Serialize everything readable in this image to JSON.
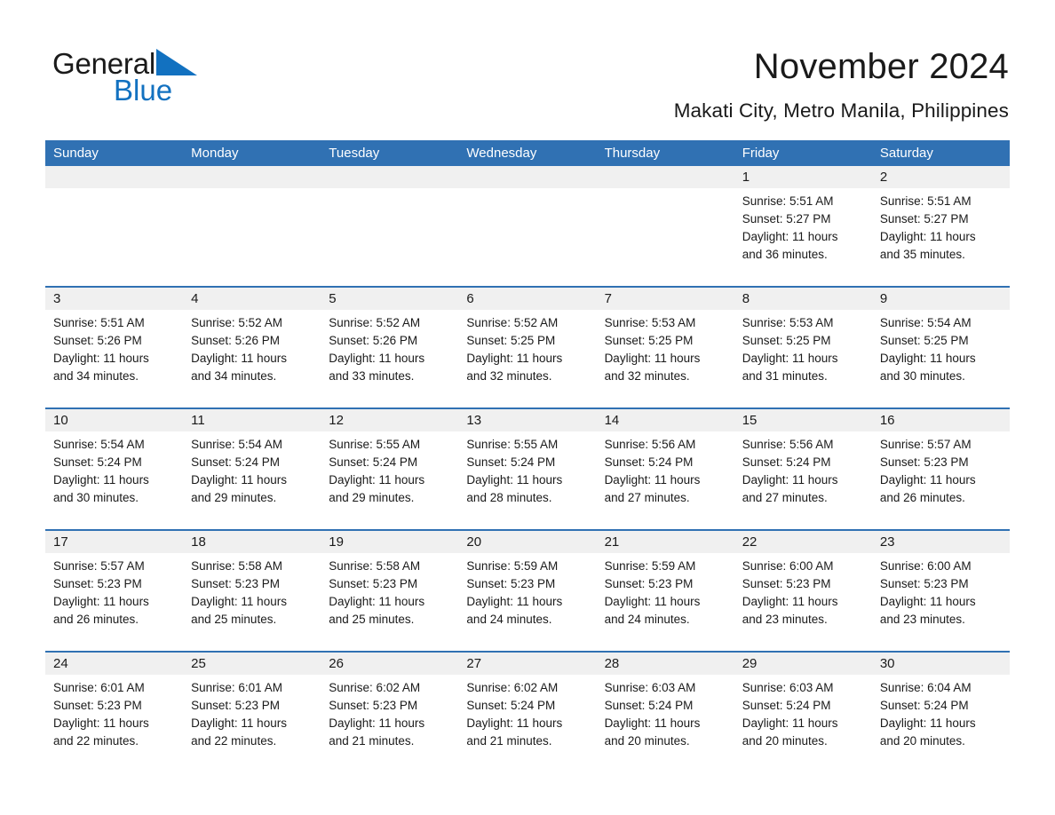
{
  "brand": {
    "word1": "General",
    "word2": "Blue",
    "triangle_color": "#1271c0",
    "icon": "triangle-logo-icon"
  },
  "header": {
    "month_title": "November 2024",
    "location": "Makati City, Metro Manila, Philippines"
  },
  "colors": {
    "header_blue": "#3071b3",
    "daynum_strip": "#f0f0f0",
    "text": "#1a1a1a",
    "brand_blue": "#1271c0"
  },
  "calendar": {
    "weekdays": [
      "Sunday",
      "Monday",
      "Tuesday",
      "Wednesday",
      "Thursday",
      "Friday",
      "Saturday"
    ],
    "weeks": [
      {
        "nums": [
          "",
          "",
          "",
          "",
          "",
          "1",
          "2"
        ],
        "cells": [
          {
            "lines": []
          },
          {
            "lines": []
          },
          {
            "lines": []
          },
          {
            "lines": []
          },
          {
            "lines": []
          },
          {
            "lines": [
              "Sunrise: 5:51 AM",
              "Sunset: 5:27 PM",
              "Daylight: 11 hours",
              "and 36 minutes."
            ]
          },
          {
            "lines": [
              "Sunrise: 5:51 AM",
              "Sunset: 5:27 PM",
              "Daylight: 11 hours",
              "and 35 minutes."
            ]
          }
        ]
      },
      {
        "nums": [
          "3",
          "4",
          "5",
          "6",
          "7",
          "8",
          "9"
        ],
        "cells": [
          {
            "lines": [
              "Sunrise: 5:51 AM",
              "Sunset: 5:26 PM",
              "Daylight: 11 hours",
              "and 34 minutes."
            ]
          },
          {
            "lines": [
              "Sunrise: 5:52 AM",
              "Sunset: 5:26 PM",
              "Daylight: 11 hours",
              "and 34 minutes."
            ]
          },
          {
            "lines": [
              "Sunrise: 5:52 AM",
              "Sunset: 5:26 PM",
              "Daylight: 11 hours",
              "and 33 minutes."
            ]
          },
          {
            "lines": [
              "Sunrise: 5:52 AM",
              "Sunset: 5:25 PM",
              "Daylight: 11 hours",
              "and 32 minutes."
            ]
          },
          {
            "lines": [
              "Sunrise: 5:53 AM",
              "Sunset: 5:25 PM",
              "Daylight: 11 hours",
              "and 32 minutes."
            ]
          },
          {
            "lines": [
              "Sunrise: 5:53 AM",
              "Sunset: 5:25 PM",
              "Daylight: 11 hours",
              "and 31 minutes."
            ]
          },
          {
            "lines": [
              "Sunrise: 5:54 AM",
              "Sunset: 5:25 PM",
              "Daylight: 11 hours",
              "and 30 minutes."
            ]
          }
        ]
      },
      {
        "nums": [
          "10",
          "11",
          "12",
          "13",
          "14",
          "15",
          "16"
        ],
        "cells": [
          {
            "lines": [
              "Sunrise: 5:54 AM",
              "Sunset: 5:24 PM",
              "Daylight: 11 hours",
              "and 30 minutes."
            ]
          },
          {
            "lines": [
              "Sunrise: 5:54 AM",
              "Sunset: 5:24 PM",
              "Daylight: 11 hours",
              "and 29 minutes."
            ]
          },
          {
            "lines": [
              "Sunrise: 5:55 AM",
              "Sunset: 5:24 PM",
              "Daylight: 11 hours",
              "and 29 minutes."
            ]
          },
          {
            "lines": [
              "Sunrise: 5:55 AM",
              "Sunset: 5:24 PM",
              "Daylight: 11 hours",
              "and 28 minutes."
            ]
          },
          {
            "lines": [
              "Sunrise: 5:56 AM",
              "Sunset: 5:24 PM",
              "Daylight: 11 hours",
              "and 27 minutes."
            ]
          },
          {
            "lines": [
              "Sunrise: 5:56 AM",
              "Sunset: 5:24 PM",
              "Daylight: 11 hours",
              "and 27 minutes."
            ]
          },
          {
            "lines": [
              "Sunrise: 5:57 AM",
              "Sunset: 5:23 PM",
              "Daylight: 11 hours",
              "and 26 minutes."
            ]
          }
        ]
      },
      {
        "nums": [
          "17",
          "18",
          "19",
          "20",
          "21",
          "22",
          "23"
        ],
        "cells": [
          {
            "lines": [
              "Sunrise: 5:57 AM",
              "Sunset: 5:23 PM",
              "Daylight: 11 hours",
              "and 26 minutes."
            ]
          },
          {
            "lines": [
              "Sunrise: 5:58 AM",
              "Sunset: 5:23 PM",
              "Daylight: 11 hours",
              "and 25 minutes."
            ]
          },
          {
            "lines": [
              "Sunrise: 5:58 AM",
              "Sunset: 5:23 PM",
              "Daylight: 11 hours",
              "and 25 minutes."
            ]
          },
          {
            "lines": [
              "Sunrise: 5:59 AM",
              "Sunset: 5:23 PM",
              "Daylight: 11 hours",
              "and 24 minutes."
            ]
          },
          {
            "lines": [
              "Sunrise: 5:59 AM",
              "Sunset: 5:23 PM",
              "Daylight: 11 hours",
              "and 24 minutes."
            ]
          },
          {
            "lines": [
              "Sunrise: 6:00 AM",
              "Sunset: 5:23 PM",
              "Daylight: 11 hours",
              "and 23 minutes."
            ]
          },
          {
            "lines": [
              "Sunrise: 6:00 AM",
              "Sunset: 5:23 PM",
              "Daylight: 11 hours",
              "and 23 minutes."
            ]
          }
        ]
      },
      {
        "nums": [
          "24",
          "25",
          "26",
          "27",
          "28",
          "29",
          "30"
        ],
        "cells": [
          {
            "lines": [
              "Sunrise: 6:01 AM",
              "Sunset: 5:23 PM",
              "Daylight: 11 hours",
              "and 22 minutes."
            ]
          },
          {
            "lines": [
              "Sunrise: 6:01 AM",
              "Sunset: 5:23 PM",
              "Daylight: 11 hours",
              "and 22 minutes."
            ]
          },
          {
            "lines": [
              "Sunrise: 6:02 AM",
              "Sunset: 5:23 PM",
              "Daylight: 11 hours",
              "and 21 minutes."
            ]
          },
          {
            "lines": [
              "Sunrise: 6:02 AM",
              "Sunset: 5:24 PM",
              "Daylight: 11 hours",
              "and 21 minutes."
            ]
          },
          {
            "lines": [
              "Sunrise: 6:03 AM",
              "Sunset: 5:24 PM",
              "Daylight: 11 hours",
              "and 20 minutes."
            ]
          },
          {
            "lines": [
              "Sunrise: 6:03 AM",
              "Sunset: 5:24 PM",
              "Daylight: 11 hours",
              "and 20 minutes."
            ]
          },
          {
            "lines": [
              "Sunrise: 6:04 AM",
              "Sunset: 5:24 PM",
              "Daylight: 11 hours",
              "and 20 minutes."
            ]
          }
        ]
      }
    ]
  }
}
